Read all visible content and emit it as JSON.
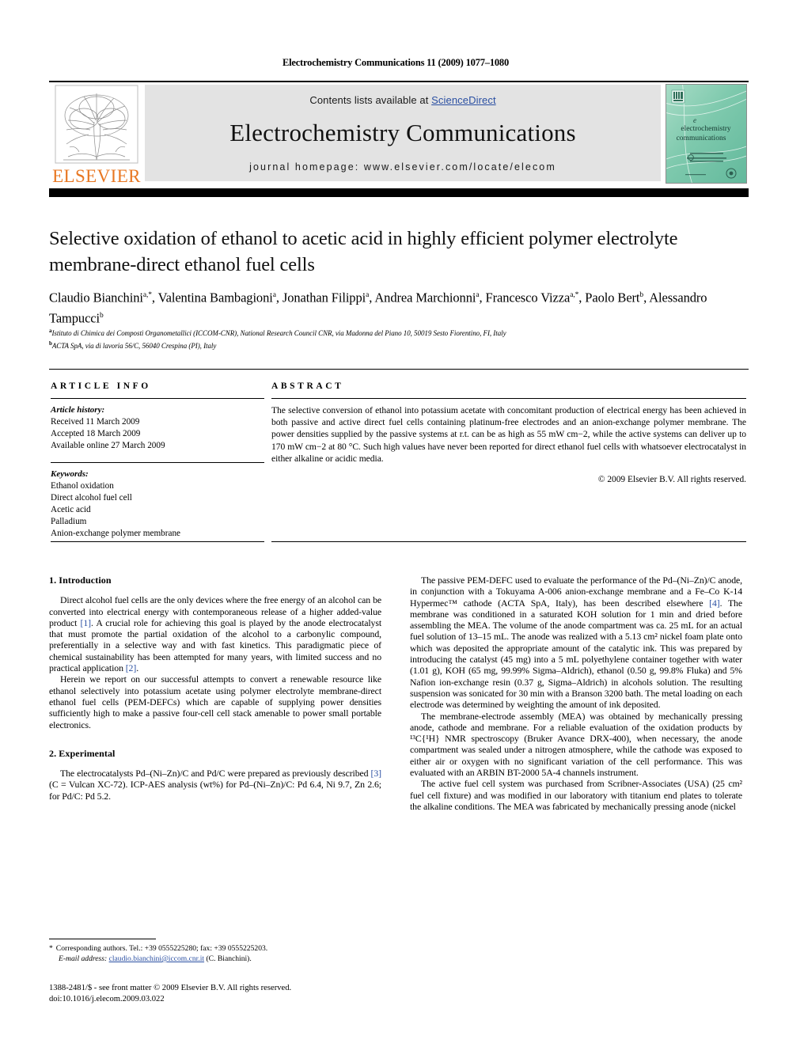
{
  "colors": {
    "link": "#2a4fa2",
    "elsevier_orange": "#e87722",
    "masthead_bg": "#e3e3e3",
    "cover_teal": "#7fc9ad"
  },
  "running_head": "Electrochemistry Communications 11 (2009) 1077–1080",
  "masthead": {
    "contents_prefix": "Contents lists available at ",
    "sciencedirect": "ScienceDirect",
    "journal_title": "Electrochemistry Communications",
    "homepage": "journal homepage: www.elsevier.com/locate/elecom",
    "elsevier_wordmark": "ELSEVIER",
    "cover_title_line1": "electrochemistry",
    "cover_title_line2": "communications"
  },
  "article": {
    "title": "Selective oxidation of ethanol to acetic acid in highly efficient polymer electrolyte membrane-direct ethanol fuel cells",
    "authors_html": "Claudio Bianchini<sup>a,*</sup>, Valentina Bambagioni<sup>a</sup>, Jonathan Filippi<sup>a</sup>, Andrea Marchionni<sup>a</sup>, Francesco Vizza<sup>a,*</sup>, Paolo Bert<sup>b</sup>, Alessandro Tampucci<sup>b</sup>",
    "affiliation_a": "Istituto di Chimica dei Composti Organometallici (ICCOM-CNR), National Research Council CNR, via Madonna del Piano 10, 50019 Sesto Fiorentino, FI, Italy",
    "affiliation_b": "ACTA SpA, via di lavoria 56/C, 56040 Crespina (PI), Italy"
  },
  "info": {
    "heading": "ARTICLE INFO",
    "history_label": "Article history:",
    "history": [
      "Received 11 March 2009",
      "Accepted 18 March 2009",
      "Available online 27 March 2009"
    ],
    "keywords_label": "Keywords:",
    "keywords": [
      "Ethanol oxidation",
      "Direct alcohol fuel cell",
      "Acetic acid",
      "Palladium",
      "Anion-exchange polymer membrane"
    ]
  },
  "abstract": {
    "heading": "ABSTRACT",
    "text": "The selective conversion of ethanol into potassium acetate with concomitant production of electrical energy has been achieved in both passive and active direct fuel cells containing platinum-free electrodes and an anion-exchange polymer membrane. The power densities supplied by the passive systems at r.t. can be as high as 55 mW cm−2, while the active systems can deliver up to 170 mW cm−2 at 80 °C. Such high values have never been reported for direct ethanol fuel cells with whatsoever electrocatalyst in either alkaline or acidic media.",
    "copyright": "© 2009 Elsevier B.V. All rights reserved."
  },
  "sections": {
    "introduction_heading": "1. Introduction",
    "intro_p1_a": "Direct alcohol fuel cells are the only devices where the free energy of an alcohol can be converted into electrical energy with contemporaneous release of a higher added-value product ",
    "intro_p1_ref1": "[1]",
    "intro_p1_b": ". A crucial role for achieving this goal is played by the anode electrocatalyst that must promote the partial oxidation of the alcohol to a carbonylic compound, preferentially in a selective way and with fast kinetics. This paradigmatic piece of chemical sustainability has been attempted for many years, with limited success and no practical application ",
    "intro_p1_ref2": "[2]",
    "intro_p1_c": ".",
    "intro_p2": "Herein we report on our successful attempts to convert a renewable resource like ethanol selectively into potassium acetate using polymer electrolyte membrane-direct ethanol fuel cells (PEM-DEFCs) which are capable of supplying power densities sufficiently high to make a passive four-cell cell stack amenable to power small portable electronics.",
    "experimental_heading": "2. Experimental",
    "exp_p1_a": "The electrocatalysts Pd–(Ni–Zn)/C and Pd/C were prepared as previously described ",
    "exp_p1_ref": "[3]",
    "exp_p1_b": " (C = Vulcan XC-72). ICP-AES analysis (wt%) for Pd–(Ni–Zn)/C: Pd 6.4, Ni 9.7, Zn 2.6; for Pd/C: Pd 5.2.",
    "right_p1_a": "The passive PEM-DEFC used to evaluate the performance of the Pd–(Ni–Zn)/C anode, in conjunction with a Tokuyama A-006 anion-exchange membrane and a Fe–Co K-14 Hypermec™ cathode (ACTA SpA, Italy), has been described elsewhere ",
    "right_p1_ref": "[4]",
    "right_p1_b": ". The membrane was conditioned in a saturated KOH solution for 1 min and dried before assembling the MEA. The volume of the anode compartment was ca. 25 mL for an actual fuel solution of 13–15 mL. The anode was realized with a 5.13 cm² nickel foam plate onto which was deposited the appropriate amount of the catalytic ink. This was prepared by introducing the catalyst (45 mg) into a 5 mL polyethylene container together with water (1.01 g), KOH (65 mg, 99.99% Sigma–Aldrich), ethanol (0.50 g, 99.8% Fluka) and 5% Nafion ion-exchange resin (0.37 g, Sigma–Aldrich) in alcohols solution. The resulting suspension was sonicated for 30 min with a Branson 3200 bath. The metal loading on each electrode was determined by weighting the amount of ink deposited.",
    "right_p2": "The membrane-electrode assembly (MEA) was obtained by mechanically pressing anode, cathode and membrane. For a reliable evaluation of the oxidation products by ¹³C{¹H} NMR spectroscopy (Bruker Avance DRX-400), when necessary, the anode compartment was sealed under a nitrogen atmosphere, while the cathode was exposed to either air or oxygen with no significant variation of the cell performance. This was evaluated with an ARBIN BT-2000 5A-4 channels instrument.",
    "right_p3": "The active fuel cell system was purchased from Scribner-Associates (USA) (25 cm² fuel cell fixture) and was modified in our laboratory with titanium end plates to tolerate the alkaline conditions. The MEA was fabricated by mechanically pressing anode (nickel"
  },
  "footnote": {
    "star": "*",
    "corresponding": "Corresponding authors. Tel.: +39 0555225280; fax: +39 0555225203.",
    "email_label": "E-mail address:",
    "email": "claudio.bianchini@iccom.cnr.it",
    "email_suffix": "(C. Bianchini)."
  },
  "imprint": {
    "line1": "1388-2481/$ - see front matter © 2009 Elsevier B.V. All rights reserved.",
    "line2": "doi:10.1016/j.elecom.2009.03.022"
  }
}
